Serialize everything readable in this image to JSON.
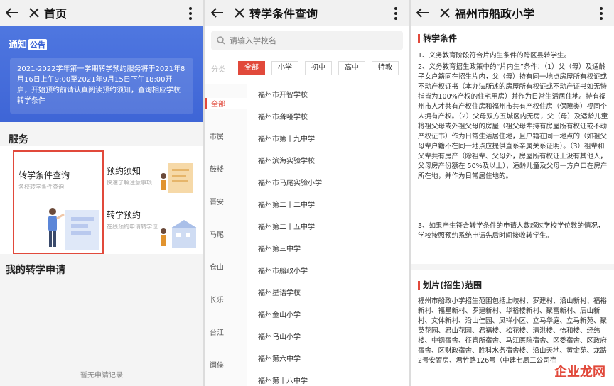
{
  "panel1": {
    "title": "首页",
    "notice_label": "通知",
    "notice_tag": "公告",
    "notice_text": "2021-2022学年第一学期转学预约服务将于2021年8月16日上午9:00至2021年9月15日下午18:00开启，开始预约前请认真阅读预约须知，查询相应学校转学条件",
    "services_title": "服务",
    "service_1_title": "转学条件查询",
    "service_1_sub": "各校转学条件查询",
    "service_2_title": "预约须知",
    "service_2_sub": "快速了解注意事项",
    "service_3_title": "转学预约",
    "service_3_sub": "在线预约申请转学位",
    "my_apps_title": "我的转学申请",
    "empty_text": "暂无申请记录"
  },
  "panel2": {
    "title": "转学条件查询",
    "search_placeholder": "请输入学校名",
    "filter_label": "分类",
    "chips": [
      "全部",
      "小学",
      "初中",
      "高中",
      "特教"
    ],
    "districts": [
      "全部",
      "市属",
      "鼓楼",
      "晋安",
      "马尾",
      "仓山",
      "长乐",
      "台江",
      "闽侯"
    ],
    "schools": [
      "福州市开智学校",
      "福州市聋哑学校",
      "福州市第十九中学",
      "福州滨海实验学校",
      "福州市马尾实验小学",
      "福州第二十二中学",
      "福州第二十五中学",
      "福州第三中学",
      "福州市船政小学",
      "福州星语学校",
      "福州金山小学",
      "福州乌山小学",
      "福州第六中学",
      "福州第十八中学"
    ]
  },
  "panel3": {
    "title": "福州市船政小学",
    "section_1_title": "转学条件",
    "section_1_items": [
      "1、义务教育阶段符合片内生条件的跨区县转学生。",
      "2、义务教育招生政策中的“片内生”条件：（1）父（母）及适龄子女户籍同在招生片内，父（母）持有同一地点房屋所有权证或不动产权证书（本办法所述的房屋所有权证或不动产证书如无特指皆为100%产权的住宅用房）并作为日常生活居住地。持有福州市人才共有产权住房和福州市共有产权住房（保障类）视同个人拥有产权。（2）父母双方五城区内无房，父（母）及适龄儿童将祖父母或外祖父母的房屋（祖父母辈持有房屋所有权证或不动产权证书）作为日常生活居住地，且户籍在同一地点的（如祖父母辈户籍不在同一地点应提供直系亲属关系证明）。（3）祖辈和父辈共有房产（除祖辈、父母外，房屋所有权证上没有其他人，父母房产份额在 50%及以上），适龄儿童及父母一方户口在房产所在地，并作为日常居住地的。",
      "3、如果产生符合转学条件的申请人数超过学校学位数的情况，学校按照预约系统申请先后时间接收转学生。"
    ],
    "section_2_title": "划片(招生)范围",
    "section_2_text": "福州市船政小学招生范围包括上岐村、罗建村、沿山新村、福裕新村、福星新村、罗建新村、华裕楼新村、聚富新村、后山新村、文体新村、沿山佳园、凤祥小区、立马华庭、立马新苑、聚英花园、君山花园、君福楼、松花楼、清洪楼、怡和楼、经纬楼、中钢宿舍、征管所宿舍、马江医院宿舍、区委宿舍、区政府宿舍、区财政宿舍、胜科水务宿舍楼、沿山天地、黄金苑、龙路2号安置房、君竹路126号（中建七局三公司宿",
    "watermark": "企业龙网"
  },
  "colors": {
    "accent": "#e1493b",
    "banner": "#3e65d6"
  }
}
